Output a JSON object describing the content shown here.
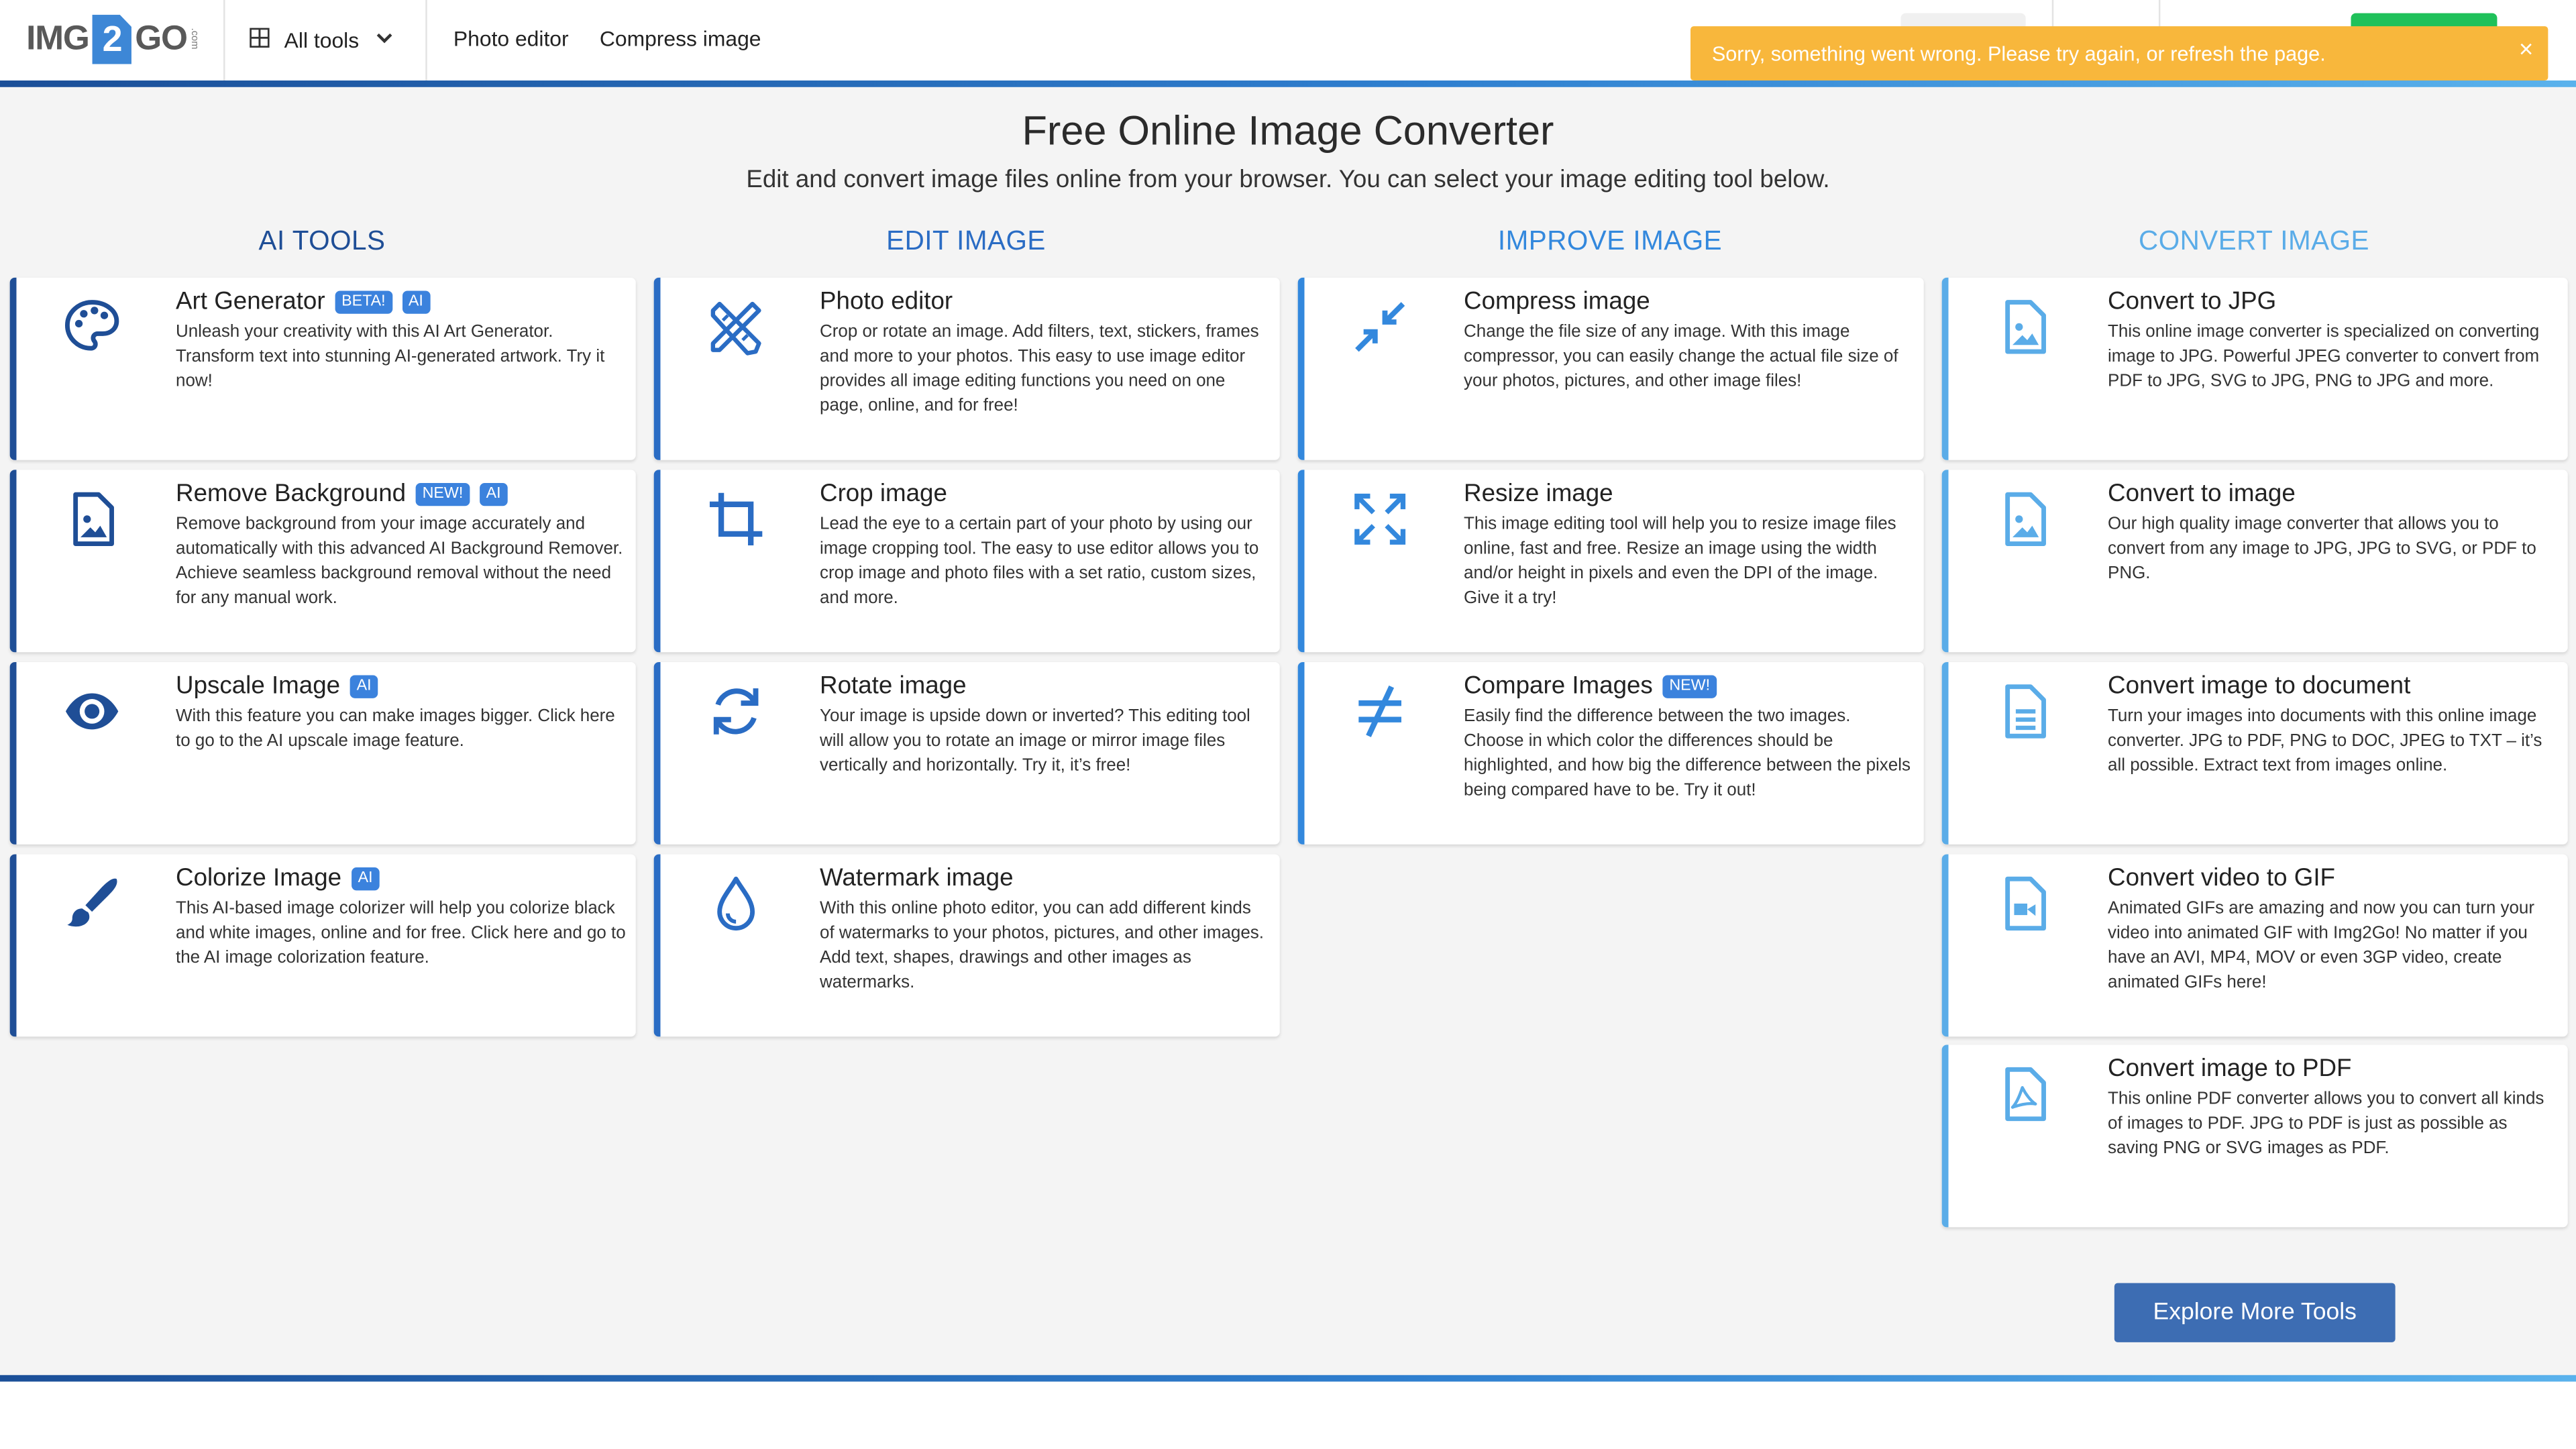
{
  "header": {
    "logo": {
      "left": "IMG",
      "two": "2",
      "right": "GO",
      "dotcom": ".com"
    },
    "all_tools_label": "All tools",
    "nav": [
      {
        "label": "Photo editor"
      },
      {
        "label": "Compress image"
      }
    ]
  },
  "toast": {
    "message": "Sorry, something went wrong. Please try again, or refresh the page.",
    "close": "×",
    "color": "#f8b73c"
  },
  "hero": {
    "title": "Free Online Image Converter",
    "subtitle": "Edit and convert image files online from your browser. You can select your image editing tool below."
  },
  "columns": [
    {
      "heading": "AI TOOLS",
      "color": "#1f4e96",
      "cards": [
        {
          "title": "Art Generator",
          "badges": [
            "BETA!",
            "AI"
          ],
          "icon": "palette-icon",
          "desc": "Unleash your creativity with this AI Art Generator. Transform text into stunning AI-generated artwork. Try it now!"
        },
        {
          "title": "Remove Background",
          "badges": [
            "NEW!",
            "AI"
          ],
          "icon": "image-file-icon",
          "desc": "Remove background from your image accurately and automatically with this advanced AI Background Remover. Achieve seamless background removal without the need for any manual work."
        },
        {
          "title": "Upscale Image",
          "badges": [
            "AI"
          ],
          "icon": "eye-icon",
          "desc": "With this feature you can make images bigger. Click here to go to the AI upscale image feature."
        },
        {
          "title": "Colorize Image",
          "badges": [
            "AI"
          ],
          "icon": "paintbrush-icon",
          "desc": "This AI-based image colorizer will help you colorize black and white images, online and for free. Click here and go to the AI image colorization feature."
        }
      ]
    },
    {
      "heading": "EDIT IMAGE",
      "color": "#2a6cc4",
      "cards": [
        {
          "title": "Photo editor",
          "badges": [],
          "icon": "pencil-ruler-icon",
          "desc": "Crop or rotate an image. Add filters, text, stickers, frames and more to your photos. This easy to use image editor provides all image editing functions you need on one page, online, and for free!"
        },
        {
          "title": "Crop image",
          "badges": [],
          "icon": "crop-icon",
          "desc": "Lead the eye to a certain part of your photo by using our image cropping tool. The easy to use editor allows you to crop image and photo files with a set ratio, custom sizes, and more."
        },
        {
          "title": "Rotate image",
          "badges": [],
          "icon": "rotate-icon",
          "desc": "Your image is upside down or inverted? This editing tool will allow you to rotate an image or mirror image files vertically and horizontally. Try it, it’s free!"
        },
        {
          "title": "Watermark image",
          "badges": [],
          "icon": "droplet-icon",
          "desc": "With this online photo editor, you can add different kinds of watermarks to your photos, pictures, and other images. Add text, shapes, drawings and other images as watermarks."
        }
      ]
    },
    {
      "heading": "IMPROVE IMAGE",
      "color": "#3388dd",
      "cards": [
        {
          "title": "Compress image",
          "badges": [],
          "icon": "compress-arrows-icon",
          "desc": "Change the file size of any image. With this image compressor, you can easily change the actual file size of your photos, pictures, and other image files!"
        },
        {
          "title": "Resize image",
          "badges": [],
          "icon": "expand-arrows-icon",
          "desc": "This image editing tool will help you to resize image files online, fast and free. Resize an image using the width and/or height in pixels and even the DPI of the image. Give it a try!"
        },
        {
          "title": "Compare Images",
          "badges": [
            "NEW!"
          ],
          "icon": "not-equal-icon",
          "desc": "Easily find the difference between the two images. Choose in which color the differences should be highlighted, and how big the difference between the pixels being compared have to be. Try it out!"
        }
      ]
    },
    {
      "heading": "CONVERT IMAGE",
      "color": "#5aace8",
      "cards": [
        {
          "title": "Convert to JPG",
          "badges": [],
          "icon": "image-file-icon",
          "desc": "This online image converter is specialized on converting image to JPG. Powerful JPEG converter to convert from PDF to JPG, SVG to JPG, PNG to JPG and more."
        },
        {
          "title": "Convert to image",
          "badges": [],
          "icon": "image-file-icon",
          "desc": "Our high quality image converter that allows you to convert from any image to JPG, JPG to SVG, or PDF to PNG."
        },
        {
          "title": "Convert image to document",
          "badges": [],
          "icon": "document-file-icon",
          "desc": "Turn your images into documents with this online image converter. JPG to PDF, PNG to DOC, JPEG to TXT – it’s all possible. Extract text from images online."
        },
        {
          "title": "Convert video to GIF",
          "badges": [],
          "icon": "video-file-icon",
          "desc": "Animated GIFs are amazing and now you can turn your video into animated GIF with Img2Go! No matter if you have an AVI, MP4, MOV or even 3GP video, create animated GIFs here!"
        },
        {
          "title": "Convert image to PDF",
          "badges": [],
          "icon": "pdf-file-icon",
          "desc": "This online PDF converter allows you to convert all kinds of images to PDF. JPG to PDF is just as possible as saving PNG or SVG images as PDF."
        }
      ]
    }
  ],
  "explore_button": "Explore More Tools"
}
